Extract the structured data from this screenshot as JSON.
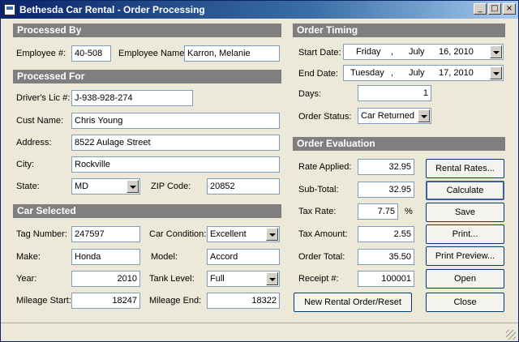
{
  "window": {
    "title": "Bethesda Car Rental - Order Processing",
    "min": "_",
    "max": "□",
    "close": "×"
  },
  "processed_by": {
    "header": "Processed By",
    "emp_num_label": "Employee #:",
    "emp_num": "40-508",
    "emp_name_label": "Employee Name:",
    "emp_name": "Karron, Melanie"
  },
  "processed_for": {
    "header": "Processed For",
    "license_label": "Driver's Lic #:",
    "license": "J-938-928-274",
    "name_label": "Cust Name:",
    "name": "Chris Young",
    "address_label": "Address:",
    "address": "8522 Aulage Street",
    "city_label": "City:",
    "city": "Rockville",
    "state_label": "State:",
    "state": "MD",
    "zip_label": "ZIP Code:",
    "zip": "20852"
  },
  "car": {
    "header": "Car Selected",
    "tag_label": "Tag Number:",
    "tag": "247597",
    "condition_label": "Car Condition:",
    "condition": "Excellent",
    "make_label": "Make:",
    "make": "Honda",
    "model_label": "Model:",
    "model": "Accord",
    "year_label": "Year:",
    "year": "2010",
    "tank_label": "Tank Level:",
    "tank": "Full",
    "mileage_start_label": "Mileage Start:",
    "mileage_start": "18247",
    "mileage_end_label": "Mileage End:",
    "mileage_end": "18322"
  },
  "timing": {
    "header": "Order Timing",
    "start_label": "Start Date:",
    "start_day": "Friday",
    "start_sep": ",",
    "start_month": "July",
    "start_date": "16, 2010",
    "end_label": "End Date:",
    "end_day": "Tuesday",
    "end_sep": ",",
    "end_month": "July",
    "end_date": "17, 2010",
    "days_label": "Days:",
    "days": "1",
    "status_label": "Order Status:",
    "status": "Car Returned"
  },
  "evaluation": {
    "header": "Order Evaluation",
    "rate_label": "Rate Applied:",
    "rate": "32.95",
    "subtotal_label": "Sub-Total:",
    "subtotal": "32.95",
    "tax_rate_label": "Tax Rate:",
    "tax_rate": "7.75",
    "percent": "%",
    "tax_amount_label": "Tax Amount:",
    "tax_amount": "2.55",
    "total_label": "Order Total:",
    "total": "35.50",
    "receipt_label": "Receipt #:",
    "receipt": "100001"
  },
  "buttons": {
    "rental_rates": "Rental Rates...",
    "calculate": "Calculate",
    "save": "Save",
    "print": "Print...",
    "print_preview": "Print Preview...",
    "open": "Open",
    "new_order": "New Rental Order/Reset",
    "close": "Close"
  }
}
